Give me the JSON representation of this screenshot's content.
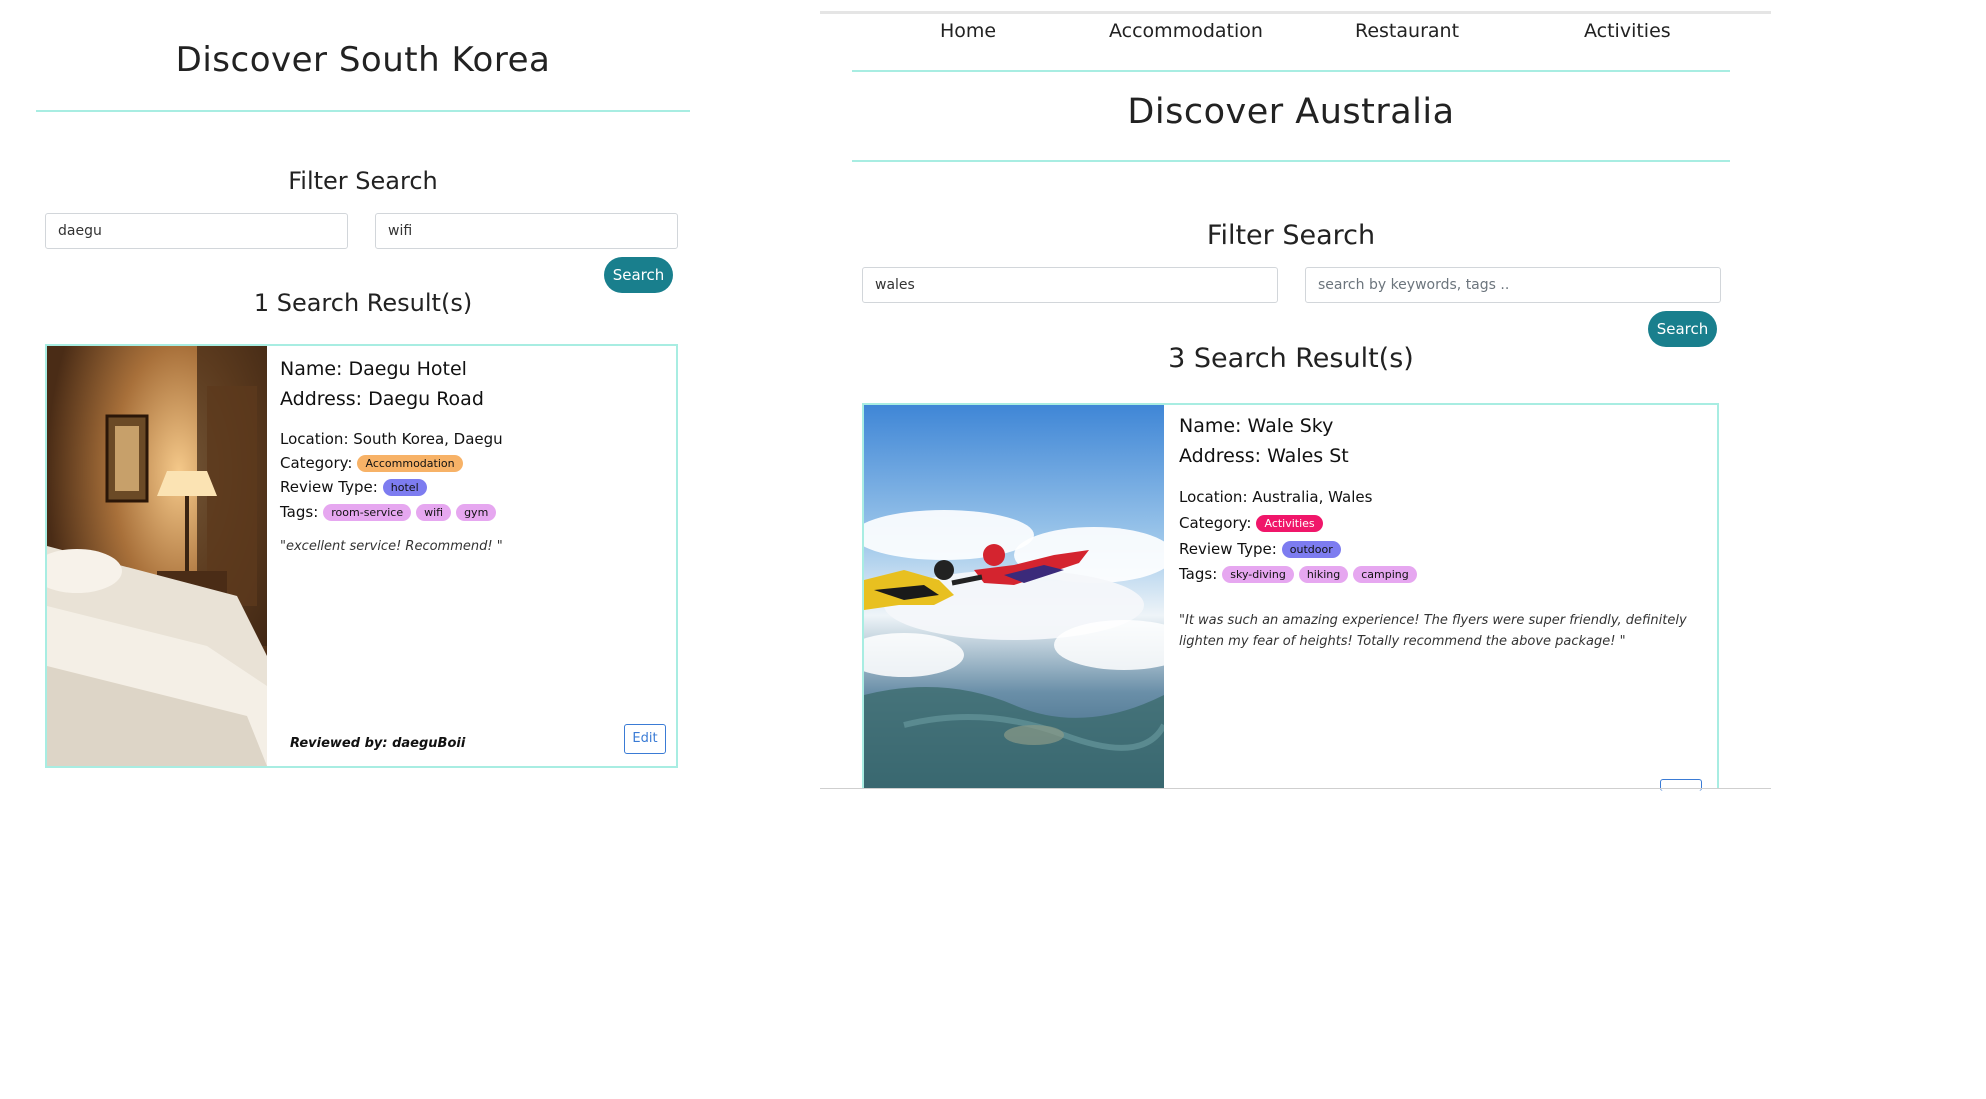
{
  "left": {
    "title": "Discover South Korea",
    "filter_heading": "Filter Search",
    "location_value": "daegu",
    "keyword_value": "wifi",
    "search_label": "Search",
    "result_count": "1 Search Result(s)",
    "card": {
      "name": "Name: Daegu Hotel",
      "address": "Address: Daegu Road",
      "location": "Location: South Korea, Daegu",
      "category_label": "Category:",
      "category": "Accommodation",
      "review_type_label": "Review Type:",
      "review_type": "hotel",
      "tags_label": "Tags:",
      "tags": [
        "room-service",
        "wifi",
        "gym"
      ],
      "review": "\"excellent service! Recommend! \"",
      "reviewer": "Reviewed by: daeguBoii",
      "edit_label": "Edit"
    }
  },
  "right": {
    "nav": [
      "Home",
      "Accommodation",
      "Restaurant",
      "Activities"
    ],
    "title": "Discover Australia",
    "filter_heading": "Filter Search",
    "location_value": "wales",
    "keyword_placeholder": "search by keywords, tags ..",
    "search_label": "Search",
    "result_count": "3 Search Result(s)",
    "card": {
      "name": "Name: Wale Sky",
      "address": "Address: Wales St",
      "location": "Location: Australia, Wales",
      "category_label": "Category:",
      "category": "Activities",
      "review_type_label": "Review Type:",
      "review_type": "outdoor",
      "tags_label": "Tags:",
      "tags": [
        "sky-diving",
        "hiking",
        "camping"
      ],
      "review_line1": "\"It was such an amazing experience! The flyers were super friendly, definitely",
      "review_line2": "lighten my fear of heights! Totally recommend the above package! \""
    }
  },
  "colors": {
    "accent_rule": "#a8ede2",
    "search_button": "#197f8d",
    "accommodation_badge": "#f7b267",
    "activities_badge": "#f0166a",
    "type_badge": "#7d7cf0",
    "tag_badge": "#e6a7f0"
  }
}
